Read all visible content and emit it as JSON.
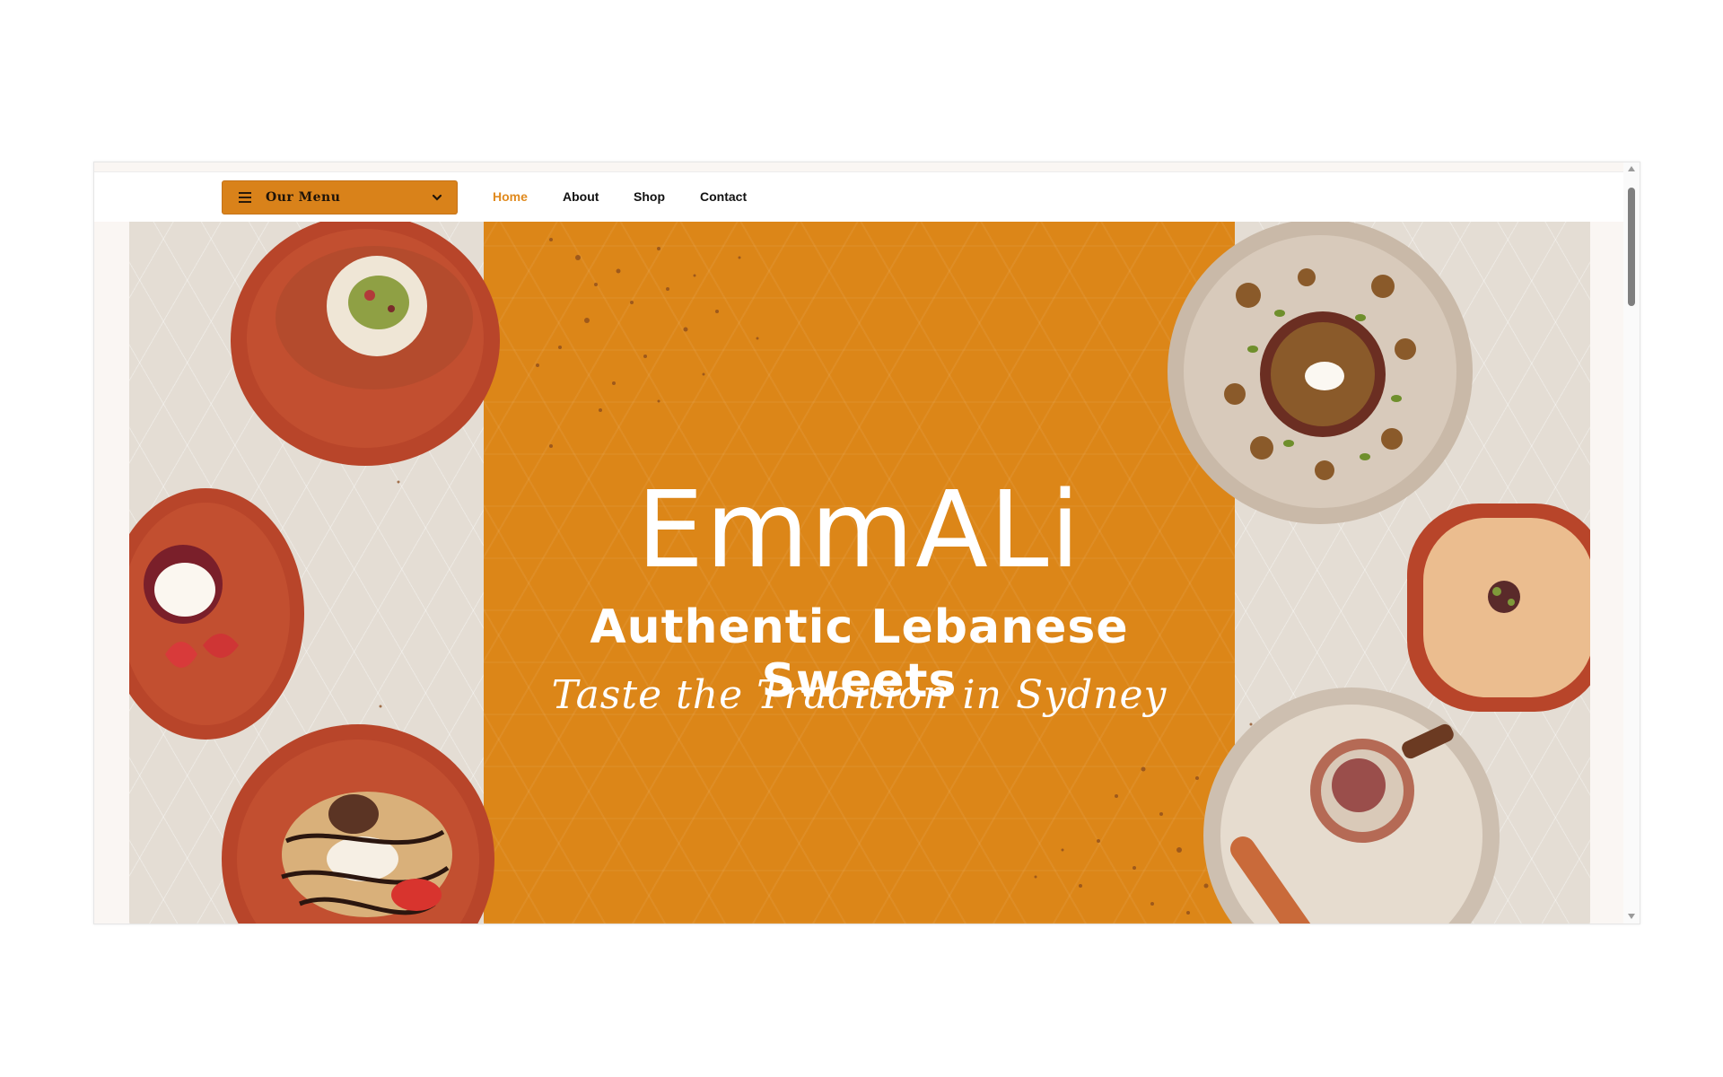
{
  "nav": {
    "menu_label": "Our Menu",
    "links": [
      {
        "label": "Home",
        "active": true
      },
      {
        "label": "About",
        "active": false
      },
      {
        "label": "Shop",
        "active": false
      },
      {
        "label": "Contact",
        "active": false
      }
    ]
  },
  "hero": {
    "brand": "EmmALi",
    "tagline": "Authentic Lebanese Sweets",
    "subline": "Taste the Tradition in Sydney"
  },
  "icons": [
    "hamburger-icon",
    "chevron-down-icon"
  ],
  "colors": {
    "accent": "#dc8618",
    "active_link": "#e08a1e",
    "side_panel": "#e4ddd4"
  }
}
